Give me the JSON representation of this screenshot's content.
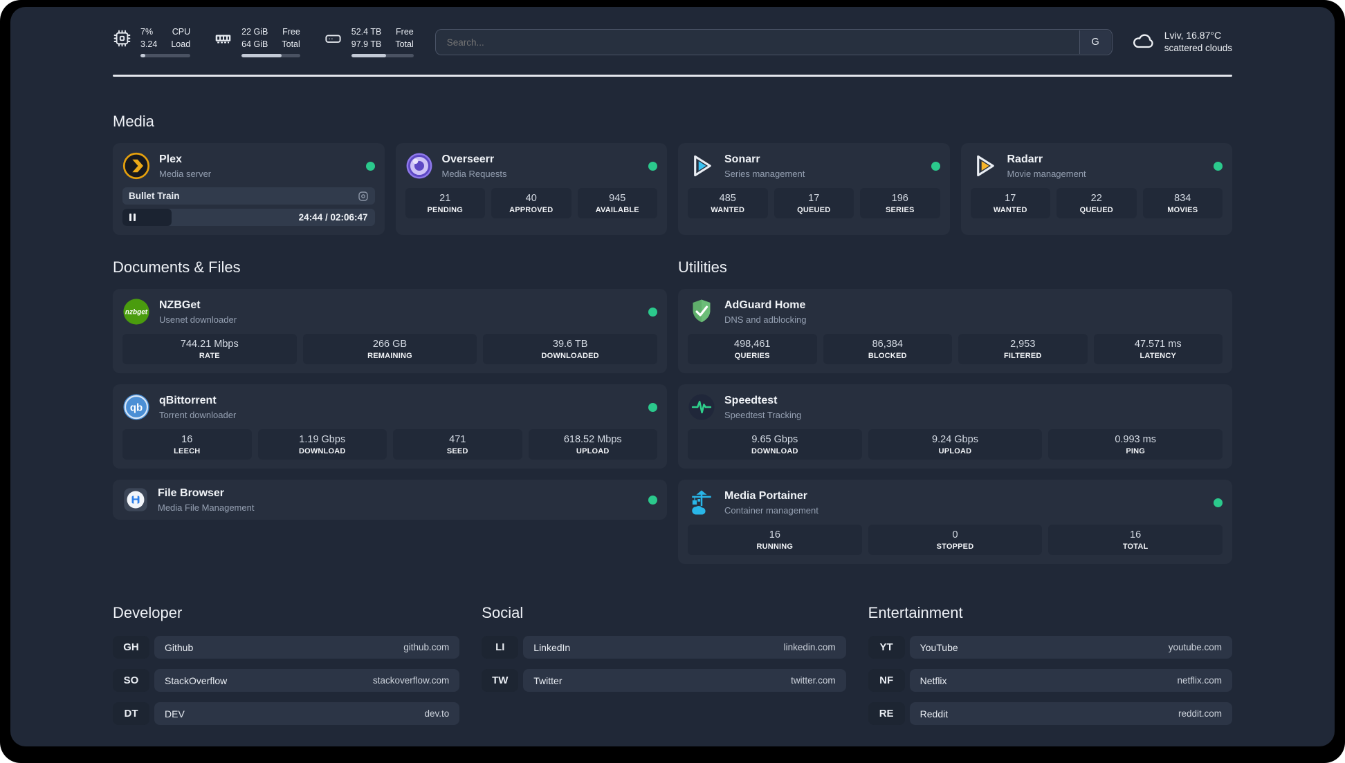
{
  "colors": {
    "status_online": "#2bc98c",
    "panel_background": "#202837",
    "card_background": "#272f3e",
    "plex_accent": "#e5a00d",
    "sonarr_accent": "#3ac2f2",
    "radarr_accent": "#f7b42a",
    "overseerr_accent": "#5d48c4",
    "nzbget_accent": "#4a9c0e",
    "qbittorrent_accent": "#4b8fd5",
    "filebrowser_accent": "#2e7fe8",
    "adguard_accent": "#5fae6b",
    "speedtest_accent": "#2fd08c",
    "portainer_accent": "#29b6e8"
  },
  "header": {
    "system_stats": [
      {
        "icon": "cpu-icon",
        "values": [
          "7%",
          "3.24"
        ],
        "labels": [
          "CPU",
          "Load"
        ],
        "progress_percent": 10
      },
      {
        "icon": "memory-icon",
        "values": [
          "22 GiB",
          "64 GiB"
        ],
        "labels": [
          "Free",
          "Total"
        ],
        "progress_percent": 68
      },
      {
        "icon": "disk-icon",
        "values": [
          "52.4 TB",
          "97.9 TB"
        ],
        "labels": [
          "Free",
          "Total"
        ],
        "progress_percent": 56
      }
    ],
    "search": {
      "placeholder": "Search...",
      "engine_button": "G"
    },
    "weather": {
      "icon": "cloud-icon",
      "location_temperature": "Lviv, 16.87°C",
      "condition": "scattered clouds"
    }
  },
  "sections": {
    "media": {
      "title": "Media",
      "plex": {
        "name": "Plex",
        "description": "Media server",
        "icon": "plex-logo-icon",
        "online": true,
        "now_playing": {
          "title": "Bullet Train",
          "state": "paused",
          "time": "24:44 / 02:06:47",
          "progress_percent": 19.5
        }
      },
      "overseerr": {
        "name": "Overseerr",
        "description": "Media Requests",
        "icon": "overseerr-logo-icon",
        "online": true,
        "stats": [
          {
            "value": "21",
            "label": "PENDING"
          },
          {
            "value": "40",
            "label": "APPROVED"
          },
          {
            "value": "945",
            "label": "AVAILABLE"
          }
        ]
      },
      "sonarr": {
        "name": "Sonarr",
        "description": "Series management",
        "icon": "sonarr-logo-icon",
        "online": true,
        "stats": [
          {
            "value": "485",
            "label": "WANTED"
          },
          {
            "value": "17",
            "label": "QUEUED"
          },
          {
            "value": "196",
            "label": "SERIES"
          }
        ]
      },
      "radarr": {
        "name": "Radarr",
        "description": "Movie management",
        "icon": "radarr-logo-icon",
        "online": true,
        "stats": [
          {
            "value": "17",
            "label": "WANTED"
          },
          {
            "value": "22",
            "label": "QUEUED"
          },
          {
            "value": "834",
            "label": "MOVIES"
          }
        ]
      }
    },
    "documents": {
      "title": "Documents & Files",
      "nzbget": {
        "name": "NZBGet",
        "description": "Usenet downloader",
        "icon": "nzbget-logo-icon",
        "online": true,
        "stats": [
          {
            "value": "744.21 Mbps",
            "label": "RATE"
          },
          {
            "value": "266 GB",
            "label": "REMAINING"
          },
          {
            "value": "39.6 TB",
            "label": "DOWNLOADED"
          }
        ]
      },
      "qbittorrent": {
        "name": "qBittorrent",
        "description": "Torrent downloader",
        "icon": "qbittorrent-logo-icon",
        "online": true,
        "stats": [
          {
            "value": "16",
            "label": "LEECH"
          },
          {
            "value": "1.19 Gbps",
            "label": "DOWNLOAD"
          },
          {
            "value": "471",
            "label": "SEED"
          },
          {
            "value": "618.52 Mbps",
            "label": "UPLOAD"
          }
        ]
      },
      "filebrowser": {
        "name": "File Browser",
        "description": "Media File Management",
        "icon": "filebrowser-logo-icon",
        "online": true
      }
    },
    "utilities": {
      "title": "Utilities",
      "adguard": {
        "name": "AdGuard Home",
        "description": "DNS and adblocking",
        "icon": "adguard-logo-icon",
        "stats": [
          {
            "value": "498,461",
            "label": "QUERIES"
          },
          {
            "value": "86,384",
            "label": "BLOCKED"
          },
          {
            "value": "2,953",
            "label": "FILTERED"
          },
          {
            "value": "47.571 ms",
            "label": "LATENCY"
          }
        ]
      },
      "speedtest": {
        "name": "Speedtest",
        "description": "Speedtest Tracking",
        "icon": "speedtest-logo-icon",
        "stats": [
          {
            "value": "9.65 Gbps",
            "label": "DOWNLOAD"
          },
          {
            "value": "9.24 Gbps",
            "label": "UPLOAD"
          },
          {
            "value": "0.993 ms",
            "label": "PING"
          }
        ]
      },
      "portainer": {
        "name": "Media Portainer",
        "description": "Container management",
        "icon": "portainer-logo-icon",
        "online": true,
        "stats": [
          {
            "value": "16",
            "label": "RUNNING"
          },
          {
            "value": "0",
            "label": "STOPPED"
          },
          {
            "value": "16",
            "label": "TOTAL"
          }
        ]
      }
    },
    "bookmarks": [
      {
        "title": "Developer",
        "links": [
          {
            "abbr": "GH",
            "name": "Github",
            "url": "github.com"
          },
          {
            "abbr": "SO",
            "name": "StackOverflow",
            "url": "stackoverflow.com"
          },
          {
            "abbr": "DT",
            "name": "DEV",
            "url": "dev.to"
          }
        ]
      },
      {
        "title": "Social",
        "links": [
          {
            "abbr": "LI",
            "name": "LinkedIn",
            "url": "linkedin.com"
          },
          {
            "abbr": "TW",
            "name": "Twitter",
            "url": "twitter.com"
          }
        ]
      },
      {
        "title": "Entertainment",
        "links": [
          {
            "abbr": "YT",
            "name": "YouTube",
            "url": "youtube.com"
          },
          {
            "abbr": "NF",
            "name": "Netflix",
            "url": "netflix.com"
          },
          {
            "abbr": "RE",
            "name": "Reddit",
            "url": "reddit.com"
          }
        ]
      }
    ]
  }
}
